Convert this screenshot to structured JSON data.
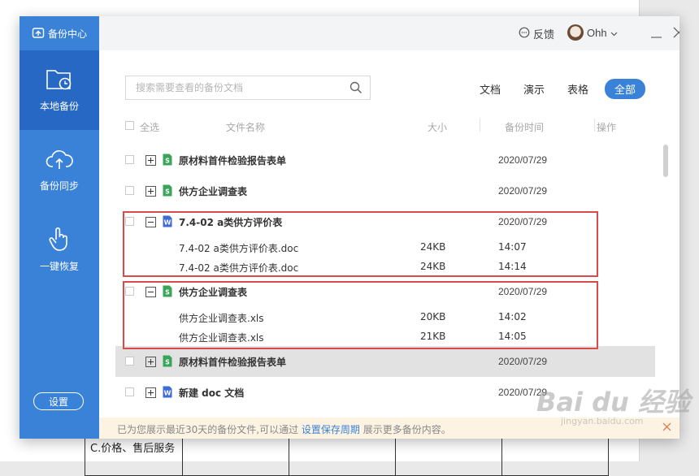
{
  "background": {
    "table_cell_text": "C.价格、售后服务"
  },
  "sidebar": {
    "brand": "备份中心",
    "items": [
      {
        "label": "本地备份",
        "icon": "folder-clock-icon",
        "active": true
      },
      {
        "label": "备份同步",
        "icon": "cloud-upload-icon",
        "active": false
      },
      {
        "label": "一键恢复",
        "icon": "hand-pointer-icon",
        "active": false
      }
    ],
    "settings_label": "设置"
  },
  "topbar": {
    "feedback_label": "反馈",
    "username": "Ohh"
  },
  "search": {
    "placeholder": "搜索需要查看的备份文档"
  },
  "filters": [
    "文档",
    "演示",
    "表格",
    "全部"
  ],
  "table_header": {
    "select_all": "全选",
    "name": "文件名称",
    "size": "大小",
    "time": "备份时间",
    "action": "操作"
  },
  "rows": [
    {
      "name": "原材料首件检验报告表单",
      "date": "2020/07/29",
      "type": "sheet",
      "expanded": false
    },
    {
      "name": "供方企业调查表",
      "date": "2020/07/29",
      "type": "sheet",
      "expanded": false
    },
    {
      "name": "7.4-02  a类供方评价表",
      "date": "2020/07/29",
      "type": "doc",
      "expanded": true,
      "children": [
        {
          "name": "7.4-02  a类供方评价表.doc",
          "size": "24KB",
          "time": "14:07"
        },
        {
          "name": "7.4-02  a类供方评价表.doc",
          "size": "24KB",
          "time": "14:14"
        }
      ]
    },
    {
      "name": "供方企业调查表",
      "date": "2020/07/29",
      "type": "sheet",
      "expanded": true,
      "children": [
        {
          "name": "供方企业调查表.xls",
          "size": "20KB",
          "time": "14:02"
        },
        {
          "name": "供方企业调查表.xls",
          "size": "21KB",
          "time": "14:05"
        }
      ]
    },
    {
      "name": "原材料首件检验报告表单",
      "date": "2020/07/29",
      "type": "sheet",
      "expanded": false
    },
    {
      "name": "新建 doc 文档",
      "date": "2020/07/29",
      "type": "doc",
      "expanded": false
    }
  ],
  "footer": {
    "message_before": "已为您展示最近30天的备份文件,可以通过 ",
    "link": "设置保存周期",
    "message_after": " 展示更多备份内容。"
  },
  "watermark": {
    "main": "Bai du 经验",
    "sub": "jingyan.baidu.com"
  },
  "colors": {
    "sidebar": "#3a82d8",
    "sidebar_active": "#2768c4",
    "sheet_icon": "#3aa55a",
    "doc_icon": "#3f6ad8",
    "highlight_box": "#d94a4a"
  }
}
